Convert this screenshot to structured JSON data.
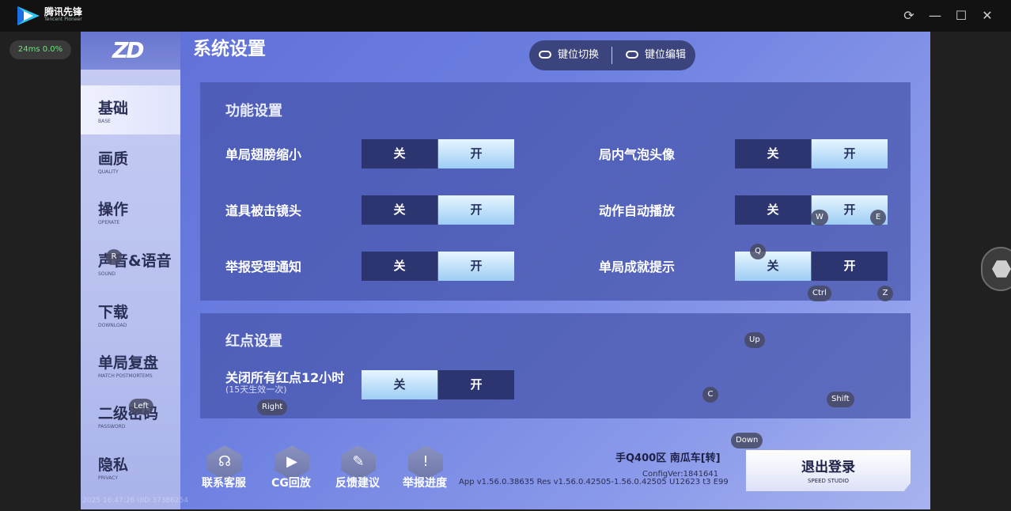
{
  "window": {
    "app_name": "腾讯先锋",
    "app_sub": "Tencent Pioneer",
    "perf": "24ms  0.0%",
    "controls": {
      "refresh": "⟳",
      "minimize": "—",
      "maximize": "☐",
      "close": "✕"
    }
  },
  "game": {
    "title": "系统设置",
    "top_buttons": {
      "key_switch": "键位切换",
      "key_edit": "键位编辑"
    },
    "nav": [
      {
        "cn": "基础",
        "en": "BASE",
        "active": true
      },
      {
        "cn": "画质",
        "en": "QUALITY"
      },
      {
        "cn": "操作",
        "en": "OPERATE"
      },
      {
        "cn": "声音&语音",
        "en": "SOUND"
      },
      {
        "cn": "下载",
        "en": "DOWNLOAD"
      },
      {
        "cn": "单局复盘",
        "en": "MATCH POSTMORTEMS"
      },
      {
        "cn": "二级密码",
        "en": "PASSWORD"
      },
      {
        "cn": "隐私",
        "en": "PRIVACY"
      }
    ],
    "function_panel": {
      "title": "功能设置",
      "off_label": "关",
      "on_label": "开",
      "rows": [
        {
          "label": "单局翅膀缩小",
          "state": "on"
        },
        {
          "label": "局内气泡头像",
          "state": "on"
        },
        {
          "label": "道具被击镜头",
          "state": "on"
        },
        {
          "label": "动作自动播放",
          "state": "on"
        },
        {
          "label": "举报受理通知",
          "state": "on"
        },
        {
          "label": "单局成就提示",
          "state": "off"
        }
      ]
    },
    "reddot_panel": {
      "title": "红点设置",
      "row": {
        "label": "关闭所有红点12小时",
        "sub": "(15天生效一次)",
        "state": "off"
      }
    },
    "bottom_buttons": [
      {
        "label": "联系客服",
        "icon": "headset-icon",
        "glyph": "☊"
      },
      {
        "label": "CG回放",
        "icon": "film-clapper-icon",
        "glyph": "▶"
      },
      {
        "label": "反馈建议",
        "icon": "edit-icon",
        "glyph": "✎"
      },
      {
        "label": "举报进度",
        "icon": "warning-icon",
        "glyph": "!"
      }
    ],
    "server": "手Q400区 南瓜车[转]",
    "config_ver": "ConfigVer:1841641",
    "app_ver": "App v1.56.0.38635 Res v1.56.0.42505-1.56.0.42505 U12623 t3 E99",
    "watermark": "2025 16:47:26 UID:37386254",
    "logout": {
      "cn": "退出登录",
      "en": "SPEED STUDIO"
    }
  },
  "key_hints": [
    "W",
    "E",
    "Q",
    "Ctrl",
    "Z",
    "Up",
    "C",
    "Shift",
    "Down",
    "Left",
    "Right",
    "R"
  ]
}
